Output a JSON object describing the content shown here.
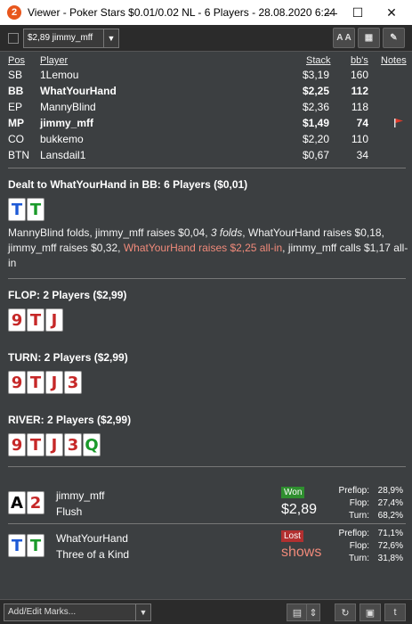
{
  "window": {
    "app_icon": "2",
    "title": "Viewer - Poker Stars $0.01/0.02 NL - 6 Players - 28.08.2020 6:24",
    "minimize": "—",
    "maximize": "☐",
    "close": "✕"
  },
  "toolbar": {
    "hand_select_value": "$2,89 jimmy_mff",
    "dropdown_arrow": "▼",
    "aa_label": "A A",
    "grid_label": "▦",
    "edit_label": "✎"
  },
  "table": {
    "headers": {
      "pos": "Pos",
      "player": "Player",
      "stack": "Stack",
      "bbs": "bb's",
      "notes": "Notes"
    },
    "rows": [
      {
        "pos": "SB",
        "player": "1Lemou",
        "stack": "$3,19",
        "bbs": "160",
        "bold": false
      },
      {
        "pos": "BB",
        "player": "WhatYourHand",
        "stack": "$2,25",
        "bbs": "112",
        "bold": true
      },
      {
        "pos": "EP",
        "player": "MannyBlind",
        "stack": "$2,36",
        "bbs": "118",
        "bold": false
      },
      {
        "pos": "MP",
        "player": "jimmy_mff",
        "stack": "$1,49",
        "bbs": "74",
        "bold": true,
        "flag": true
      },
      {
        "pos": "CO",
        "player": "bukkemo",
        "stack": "$2,20",
        "bbs": "110",
        "bold": false
      },
      {
        "pos": "BTN",
        "player": "Lansdail1",
        "stack": "$0,67",
        "bbs": "34",
        "bold": false
      }
    ],
    "flag_color": "#e03a2a"
  },
  "preflop": {
    "title": "Dealt to WhatYourHand in BB: 6 Players ($0,01)",
    "cards": [
      {
        "rank": "T",
        "suit": "d"
      },
      {
        "rank": "T",
        "suit": "c"
      }
    ],
    "actions_1": "MannyBlind folds, jimmy_mff raises $0,04, ",
    "actions_folds": "3 folds",
    "actions_2": ", WhatYourHand raises $0,18, jimmy_mff raises $0,32, ",
    "actions_allin": "WhatYourHand raises $2,25 all-in",
    "actions_3": ", jimmy_mff calls $1,17 all-in"
  },
  "flop": {
    "title": "FLOP: 2 Players ($2,99)",
    "cards": [
      {
        "rank": "9",
        "suit": "h"
      },
      {
        "rank": "T",
        "suit": "h"
      },
      {
        "rank": "J",
        "suit": "h"
      }
    ]
  },
  "turn": {
    "title": "TURN: 2 Players ($2,99)",
    "cards": [
      {
        "rank": "9",
        "suit": "h"
      },
      {
        "rank": "T",
        "suit": "h"
      },
      {
        "rank": "J",
        "suit": "h"
      },
      {
        "rank": "3",
        "suit": "h"
      }
    ]
  },
  "river": {
    "title": "RIVER: 2 Players ($2,99)",
    "cards": [
      {
        "rank": "9",
        "suit": "h"
      },
      {
        "rank": "T",
        "suit": "h"
      },
      {
        "rank": "J",
        "suit": "h"
      },
      {
        "rank": "3",
        "suit": "h"
      },
      {
        "rank": "Q",
        "suit": "c"
      }
    ]
  },
  "results": [
    {
      "cards": [
        {
          "rank": "A",
          "suit": "s"
        },
        {
          "rank": "2",
          "suit": "h"
        }
      ],
      "player": "jimmy_mff",
      "hand": "Flush",
      "badge": "Won",
      "amount": "$2,89",
      "preflop_label": "Preflop:",
      "preflop": "28,9%",
      "flop_label": "Flop:",
      "flop": "27,4%",
      "turn_label": "Turn:",
      "turn": "68,2%"
    },
    {
      "cards": [
        {
          "rank": "T",
          "suit": "d"
        },
        {
          "rank": "T",
          "suit": "c"
        }
      ],
      "player": "WhatYourHand",
      "hand": "Three of a Kind",
      "badge": "Lost",
      "amount": "shows",
      "preflop_label": "Preflop:",
      "preflop": "71,1%",
      "flop_label": "Flop:",
      "flop": "72,6%",
      "turn_label": "Turn:",
      "turn": "31,8%"
    }
  ],
  "bottombar": {
    "marks_placeholder": "Add/Edit Marks...",
    "dropdown_arrow": "▼",
    "notes_icon": "▤",
    "spin_icon": "⇕",
    "refresh_icon": "↻",
    "save_icon": "▣",
    "twitter_icon": "t"
  },
  "colors": {
    "background": "#3c3f41",
    "diamonds": "#1e5ad6",
    "hearts": "#c62828",
    "spades": "#000000",
    "clubs": "#1a9a2a",
    "won": "#2f8f2f",
    "lost": "#b23030",
    "allin_text": "#f08a7a"
  }
}
